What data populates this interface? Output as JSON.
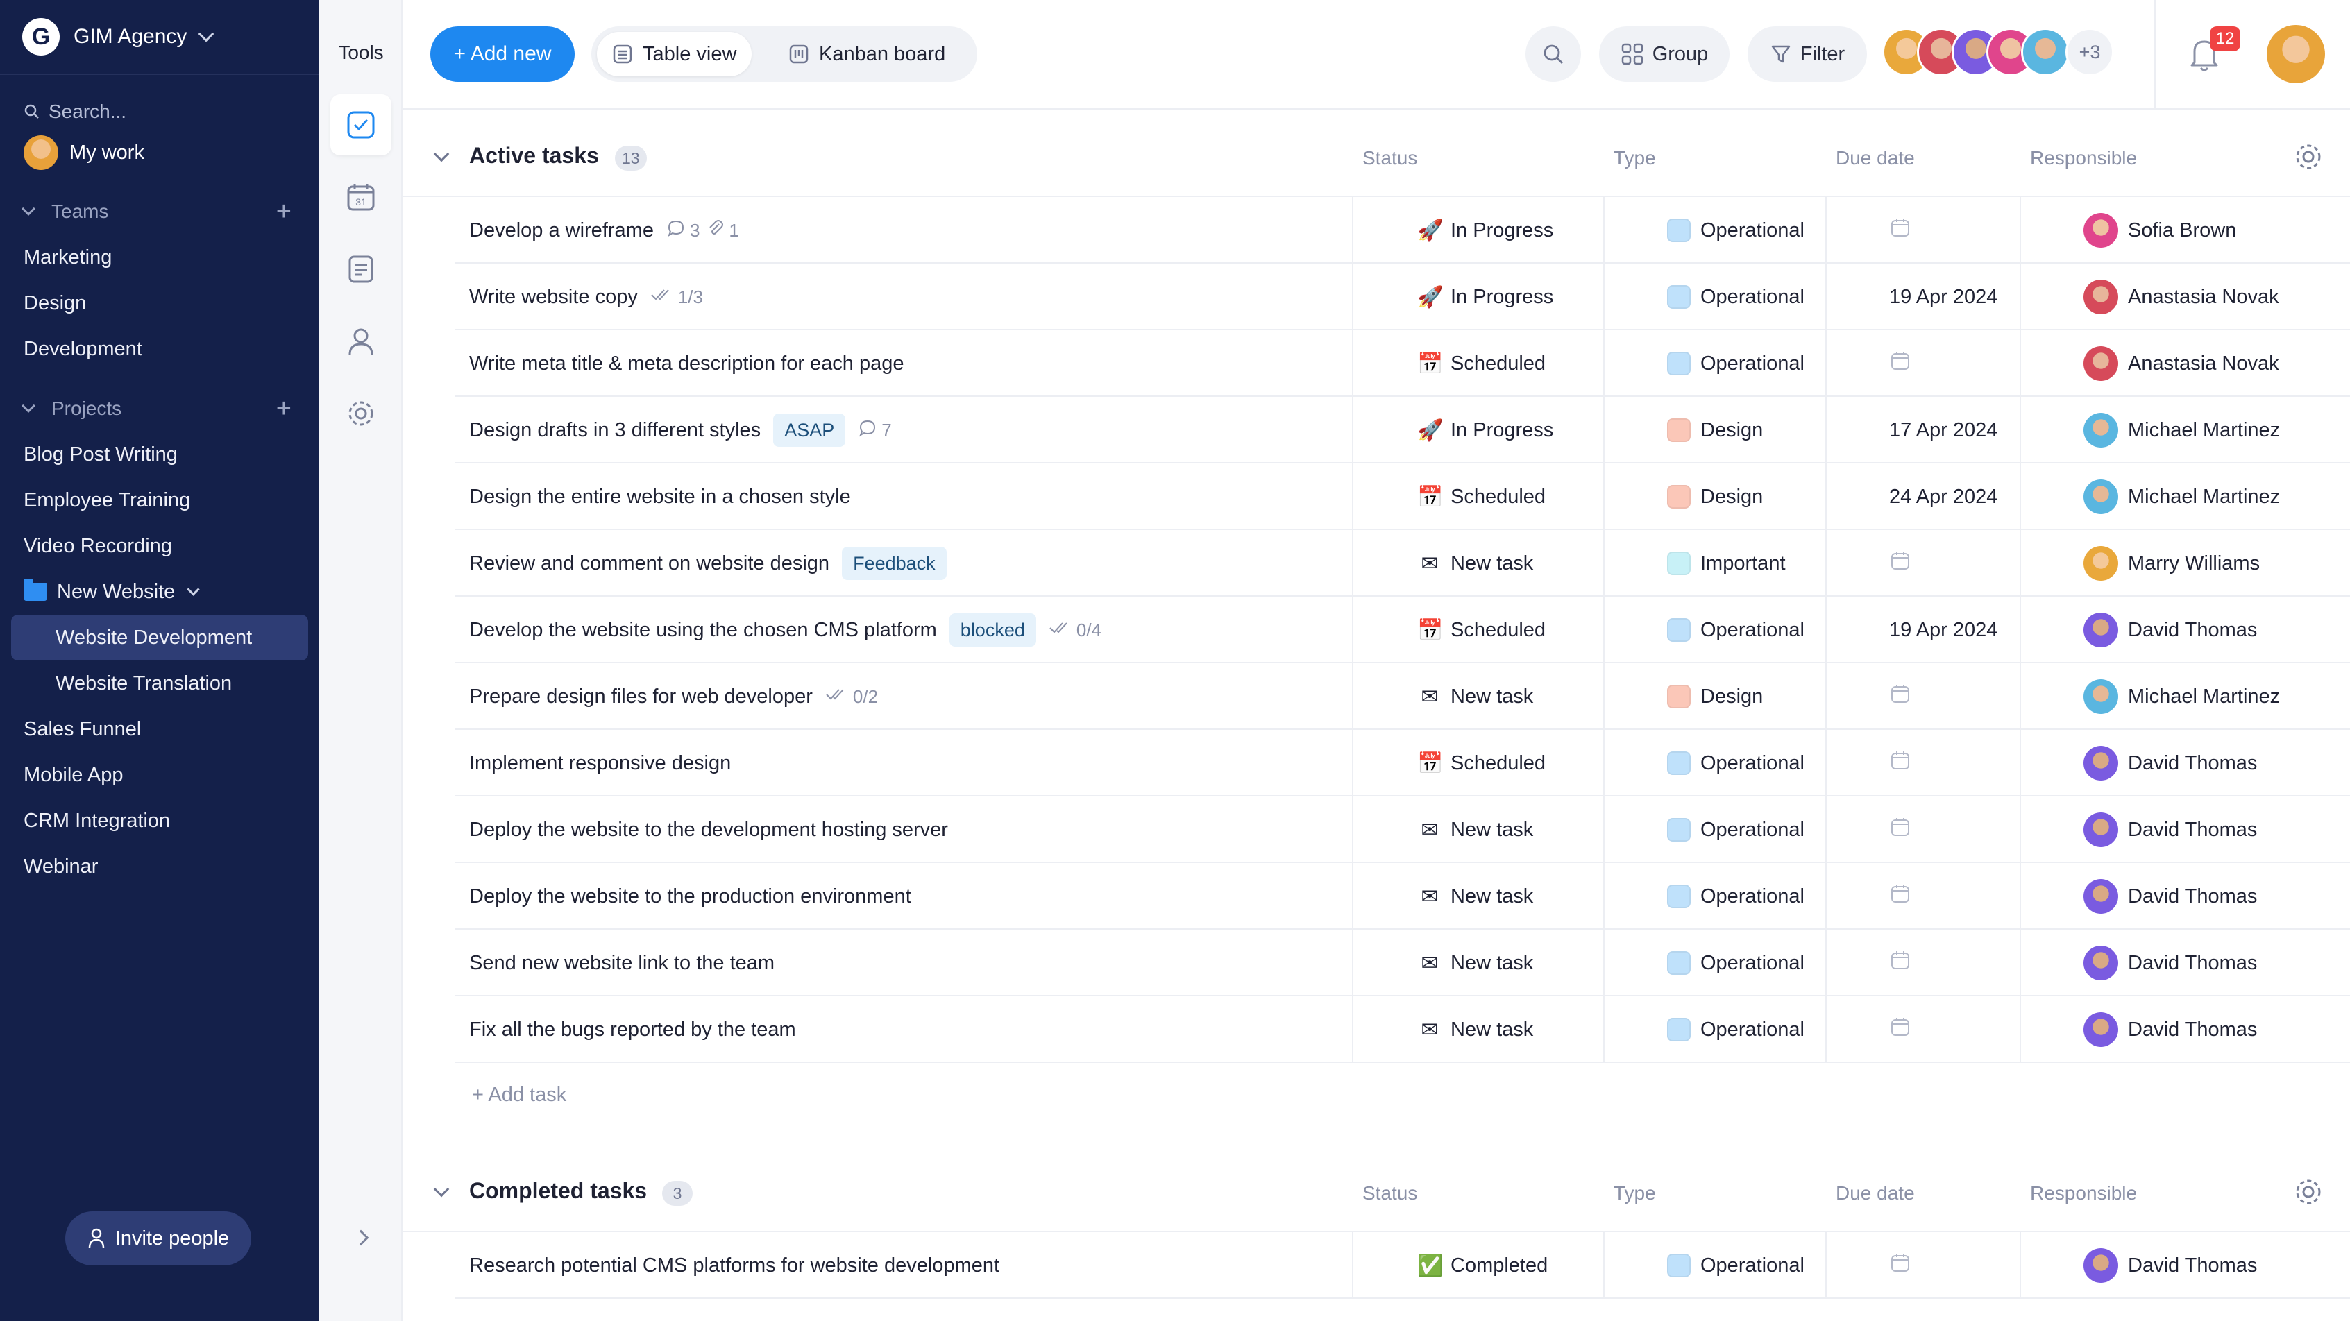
{
  "workspace": {
    "logo_letter": "G",
    "name": "GIM Agency"
  },
  "sidebar": {
    "search_placeholder": "Search...",
    "my_work": "My work",
    "teams_label": "Teams",
    "teams": [
      "Marketing",
      "Design",
      "Development"
    ],
    "projects_label": "Projects",
    "projects": [
      "Blog Post Writing",
      "Employee Training",
      "Video Recording"
    ],
    "folder": "New Website",
    "folder_items": [
      "Website Development",
      "Website Translation"
    ],
    "projects_after": [
      "Sales Funnel",
      "Mobile App",
      "CRM Integration",
      "Webinar"
    ],
    "invite": "Invite people",
    "active_item": "Website Development"
  },
  "tools": {
    "title": "Tools",
    "icons": [
      "task-check-icon",
      "calendar-icon",
      "document-icon",
      "person-icon",
      "settings-icon"
    ],
    "calendar_day": "31"
  },
  "toolbar": {
    "add_new": "+ Add new",
    "table_view": "Table view",
    "kanban": "Kanban board",
    "group": "Group",
    "filter": "Filter",
    "more_members": "+3",
    "notifications": "12"
  },
  "columns": {
    "status": "Status",
    "type": "Type",
    "due": "Due date",
    "responsible": "Responsible"
  },
  "colors": {
    "accent": "#1e88f0",
    "sidebar": "#14204a",
    "operational": "#bfe1fb",
    "design": "#fbc7b8",
    "important": "#c8f1f7"
  },
  "active_group": {
    "title": "Active tasks",
    "count": "13",
    "add_task": "+ Add task",
    "tasks": [
      {
        "name": "Develop a wireframe",
        "comments": "3",
        "attachments": "1",
        "status": "In Progress",
        "status_icon": "🚀",
        "type": "Operational",
        "due": "",
        "responsible": "Sofia Brown"
      },
      {
        "name": "Write website copy",
        "subtasks": "1/3",
        "status": "In Progress",
        "status_icon": "🚀",
        "type": "Operational",
        "due": "19 Apr 2024",
        "responsible": "Anastasia Novak"
      },
      {
        "name": "Write meta title & meta description for each page",
        "status": "Scheduled",
        "status_icon": "📅",
        "type": "Operational",
        "due": "",
        "responsible": "Anastasia Novak"
      },
      {
        "name": "Design drafts in 3 different styles",
        "tag": "ASAP",
        "comments": "7",
        "status": "In Progress",
        "status_icon": "🚀",
        "type": "Design",
        "due": "17 Apr 2024",
        "responsible": "Michael Martinez"
      },
      {
        "name": "Design the entire website in a chosen style",
        "status": "Scheduled",
        "status_icon": "📅",
        "type": "Design",
        "due": "24 Apr 2024",
        "responsible": "Michael Martinez"
      },
      {
        "name": "Review and comment on website design",
        "tag": "Feedback",
        "status": "New task",
        "status_icon": "✉",
        "type": "Important",
        "due": "",
        "responsible": "Marry Williams"
      },
      {
        "name": "Develop the website using the chosen CMS platform",
        "tag": "blocked",
        "subtasks": "0/4",
        "status": "Scheduled",
        "status_icon": "📅",
        "type": "Operational",
        "due": "19 Apr 2024",
        "responsible": "David Thomas"
      },
      {
        "name": "Prepare design files for web developer",
        "subtasks": "0/2",
        "status": "New task",
        "status_icon": "✉",
        "type": "Design",
        "due": "",
        "responsible": "Michael Martinez"
      },
      {
        "name": "Implement responsive design",
        "status": "Scheduled",
        "status_icon": "📅",
        "type": "Operational",
        "due": "",
        "responsible": "David Thomas"
      },
      {
        "name": "Deploy the website to the development hosting server",
        "status": "New task",
        "status_icon": "✉",
        "type": "Operational",
        "due": "",
        "responsible": "David Thomas"
      },
      {
        "name": "Deploy the website to the production environment",
        "status": "New task",
        "status_icon": "✉",
        "type": "Operational",
        "due": "",
        "responsible": "David Thomas"
      },
      {
        "name": "Send new website link to the team",
        "status": "New task",
        "status_icon": "✉",
        "type": "Operational",
        "due": "",
        "responsible": "David Thomas"
      },
      {
        "name": "Fix all the bugs reported by the team",
        "status": "New task",
        "status_icon": "✉",
        "type": "Operational",
        "due": "",
        "responsible": "David Thomas"
      }
    ]
  },
  "completed_group": {
    "title": "Completed tasks",
    "count": "3",
    "tasks": [
      {
        "name": "Research potential CMS platforms for website development",
        "status": "Completed",
        "status_icon": "✅",
        "type": "Operational",
        "due": "",
        "responsible": "David Thomas"
      }
    ]
  }
}
